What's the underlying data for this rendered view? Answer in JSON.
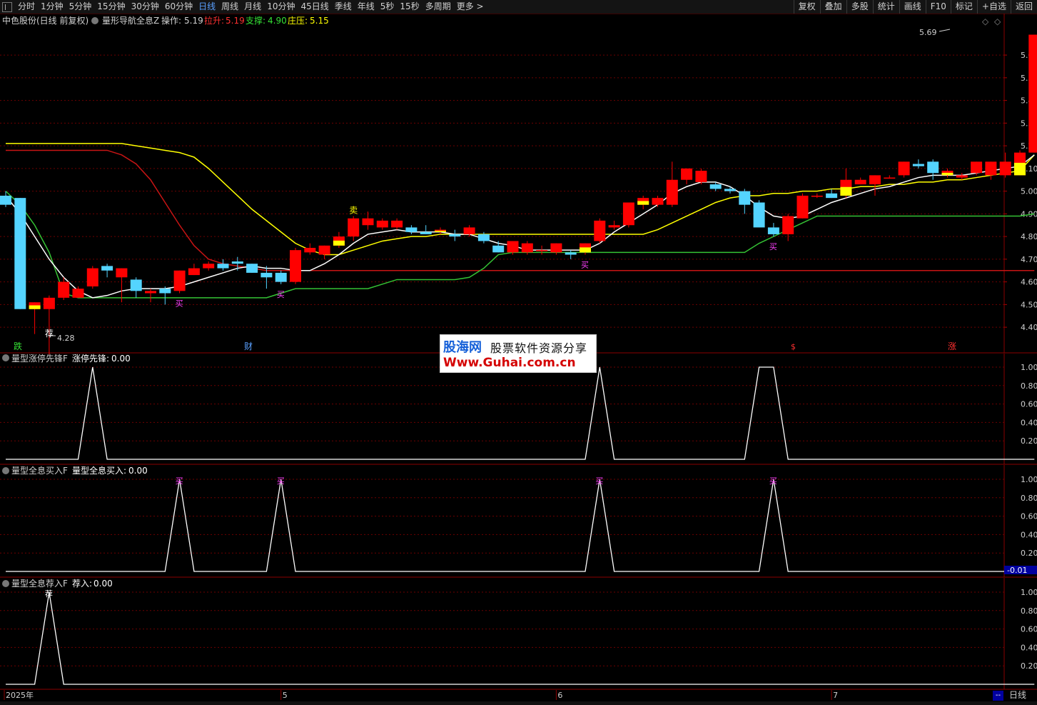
{
  "toolbar": {
    "periods": [
      "分时",
      "1分钟",
      "5分钟",
      "15分钟",
      "30分钟",
      "60分钟",
      "日线",
      "周线",
      "月线",
      "10分钟",
      "45日线",
      "季线",
      "年线",
      "5秒",
      "15秒",
      "多周期",
      "更多 >"
    ],
    "active_index": 6,
    "right_buttons": [
      "复权",
      "叠加",
      "多股",
      "统计",
      "画线",
      "F10",
      "标记",
      "+自选",
      "返回"
    ]
  },
  "main_panel": {
    "stock_label": "中色股份(日线 前复权)",
    "indicator_name": "量形导航全息Z",
    "op_label": "操作:",
    "op_value": "5.19",
    "lift_label": "拉升:",
    "lift_value": "5.19",
    "support_label": "支撑:",
    "support_value": "4.90",
    "dealer_label": "庄压:",
    "dealer_value": "5.15",
    "high_mark": "5.69",
    "low_mark": "4.28",
    "price_ticks": [
      "5.60",
      "5.50",
      "5.40",
      "5.30",
      "5.20",
      "5.10",
      "5.00",
      "4.90",
      "4.80",
      "4.70",
      "4.60",
      "4.50",
      "4.40"
    ],
    "signal_buy": "买",
    "signal_sell": "卖",
    "signal_store": "荐",
    "bottom_tags": {
      "left": "跌",
      "mid": "财",
      "r1": "$",
      "right": "涨"
    }
  },
  "panel1": {
    "indicator_name": "量型涨停先锋F",
    "label": "涨停先锋:",
    "value": "0.00",
    "ticks": [
      "1.00",
      "0.80",
      "0.60",
      "0.40",
      "0.20"
    ]
  },
  "panel2": {
    "indicator_name": "量型全息买入F",
    "label": "量型全息买入:",
    "value": "0.00",
    "ticks": [
      "1.00",
      "0.80",
      "0.60",
      "0.40",
      "0.20"
    ],
    "neg_value": "-0.01",
    "marker": "买"
  },
  "panel3": {
    "indicator_name": "量型全息荐入F",
    "label": "荐入:",
    "value": "0.00",
    "ticks": [
      "1.00",
      "0.80",
      "0.60",
      "0.40",
      "0.20"
    ],
    "marker": "荐"
  },
  "time_axis": {
    "labels": [
      "2025年",
      "5",
      "6",
      "7"
    ]
  },
  "scale_box": "--",
  "period_tag": "日线",
  "watermark": {
    "title": "股海网",
    "subtitle": "股票软件资源分享",
    "url": "Www.Guhai.com.cn"
  },
  "colors": {
    "up": "#ff0000",
    "down": "#54d4ff",
    "yellow": "#ffff00",
    "white": "#ffffff",
    "green": "#34c234",
    "darkred": "#c81414",
    "magenta": "#ff40ff",
    "grid": "#6e0000"
  },
  "chart_data": {
    "type": "candlestick",
    "ylim": [
      4.35,
      5.72
    ],
    "candles": [
      {
        "o": 4.98,
        "h": 5.0,
        "l": 4.93,
        "c": 4.94
      },
      {
        "o": 4.97,
        "h": 4.97,
        "l": 4.48,
        "c": 4.48
      },
      {
        "o": 4.48,
        "h": 4.51,
        "l": 4.37,
        "c": 4.51
      },
      {
        "o": 4.48,
        "h": 4.54,
        "l": 4.28,
        "c": 4.53
      },
      {
        "o": 4.53,
        "h": 4.62,
        "l": 4.52,
        "c": 4.6
      },
      {
        "o": 4.53,
        "h": 4.58,
        "l": 4.53,
        "c": 4.57
      },
      {
        "o": 4.58,
        "h": 4.67,
        "l": 4.57,
        "c": 4.66
      },
      {
        "o": 4.67,
        "h": 4.68,
        "l": 4.62,
        "c": 4.65
      },
      {
        "o": 4.62,
        "h": 4.66,
        "l": 4.51,
        "c": 4.66
      },
      {
        "o": 4.61,
        "h": 4.62,
        "l": 4.53,
        "c": 4.56
      },
      {
        "o": 4.55,
        "h": 4.57,
        "l": 4.51,
        "c": 4.56
      },
      {
        "o": 4.57,
        "h": 4.58,
        "l": 4.5,
        "c": 4.55
      },
      {
        "o": 4.56,
        "h": 4.65,
        "l": 4.55,
        "c": 4.65
      },
      {
        "o": 4.63,
        "h": 4.68,
        "l": 4.63,
        "c": 4.66
      },
      {
        "o": 4.66,
        "h": 4.69,
        "l": 4.65,
        "c": 4.68
      },
      {
        "o": 4.68,
        "h": 4.7,
        "l": 4.65,
        "c": 4.66
      },
      {
        "o": 4.69,
        "h": 4.71,
        "l": 4.65,
        "c": 4.68
      },
      {
        "o": 4.68,
        "h": 4.68,
        "l": 4.64,
        "c": 4.64
      },
      {
        "o": 4.64,
        "h": 4.67,
        "l": 4.57,
        "c": 4.62
      },
      {
        "o": 4.64,
        "h": 4.65,
        "l": 4.59,
        "c": 4.6
      },
      {
        "o": 4.6,
        "h": 4.75,
        "l": 4.59,
        "c": 4.74
      },
      {
        "o": 4.73,
        "h": 4.77,
        "l": 4.72,
        "c": 4.75
      },
      {
        "o": 4.72,
        "h": 4.76,
        "l": 4.7,
        "c": 4.76
      },
      {
        "o": 4.76,
        "h": 4.82,
        "l": 4.75,
        "c": 4.8
      },
      {
        "o": 4.8,
        "h": 4.89,
        "l": 4.78,
        "c": 4.88
      },
      {
        "o": 4.85,
        "h": 4.91,
        "l": 4.83,
        "c": 4.88
      },
      {
        "o": 4.84,
        "h": 4.88,
        "l": 4.83,
        "c": 4.87
      },
      {
        "o": 4.84,
        "h": 4.88,
        "l": 4.83,
        "c": 4.87
      },
      {
        "o": 4.84,
        "h": 4.85,
        "l": 4.81,
        "c": 4.82
      },
      {
        "o": 4.82,
        "h": 4.85,
        "l": 4.81,
        "c": 4.81
      },
      {
        "o": 4.82,
        "h": 4.84,
        "l": 4.81,
        "c": 4.83
      },
      {
        "o": 4.81,
        "h": 4.83,
        "l": 4.78,
        "c": 4.8
      },
      {
        "o": 4.81,
        "h": 4.85,
        "l": 4.8,
        "c": 4.84
      },
      {
        "o": 4.81,
        "h": 4.82,
        "l": 4.77,
        "c": 4.78
      },
      {
        "o": 4.76,
        "h": 4.78,
        "l": 4.73,
        "c": 4.73
      },
      {
        "o": 4.73,
        "h": 4.78,
        "l": 4.72,
        "c": 4.78
      },
      {
        "o": 4.73,
        "h": 4.78,
        "l": 4.72,
        "c": 4.77
      },
      {
        "o": 4.74,
        "h": 4.76,
        "l": 4.72,
        "c": 4.74
      },
      {
        "o": 4.73,
        "h": 4.77,
        "l": 4.72,
        "c": 4.77
      },
      {
        "o": 4.73,
        "h": 4.74,
        "l": 4.7,
        "c": 4.72
      },
      {
        "o": 4.73,
        "h": 4.77,
        "l": 4.72,
        "c": 4.77
      },
      {
        "o": 4.78,
        "h": 4.88,
        "l": 4.77,
        "c": 4.87
      },
      {
        "o": 4.84,
        "h": 4.87,
        "l": 4.83,
        "c": 4.85
      },
      {
        "o": 4.85,
        "h": 4.95,
        "l": 4.84,
        "c": 4.95
      },
      {
        "o": 4.94,
        "h": 4.98,
        "l": 4.92,
        "c": 4.97
      },
      {
        "o": 4.94,
        "h": 4.98,
        "l": 4.93,
        "c": 4.97
      },
      {
        "o": 4.94,
        "h": 5.13,
        "l": 4.93,
        "c": 5.05
      },
      {
        "o": 5.05,
        "h": 5.1,
        "l": 5.03,
        "c": 5.1
      },
      {
        "o": 5.04,
        "h": 5.1,
        "l": 5.03,
        "c": 5.09
      },
      {
        "o": 5.03,
        "h": 5.04,
        "l": 5.0,
        "c": 5.01
      },
      {
        "o": 5.01,
        "h": 5.02,
        "l": 4.99,
        "c": 5.0
      },
      {
        "o": 5.0,
        "h": 5.01,
        "l": 4.9,
        "c": 4.94
      },
      {
        "o": 4.95,
        "h": 4.96,
        "l": 4.85,
        "c": 4.84
      },
      {
        "o": 4.84,
        "h": 4.86,
        "l": 4.8,
        "c": 4.81
      },
      {
        "o": 4.81,
        "h": 4.9,
        "l": 4.78,
        "c": 4.89
      },
      {
        "o": 4.88,
        "h": 4.99,
        "l": 4.88,
        "c": 4.98
      },
      {
        "o": 4.98,
        "h": 4.99,
        "l": 4.97,
        "c": 4.98
      },
      {
        "o": 4.99,
        "h": 5.01,
        "l": 4.97,
        "c": 4.97
      },
      {
        "o": 4.98,
        "h": 5.1,
        "l": 4.97,
        "c": 5.05
      },
      {
        "o": 5.03,
        "h": 5.06,
        "l": 5.03,
        "c": 5.05
      },
      {
        "o": 5.03,
        "h": 5.07,
        "l": 4.98,
        "c": 5.07
      },
      {
        "o": 5.06,
        "h": 5.07,
        "l": 5.06,
        "c": 5.06
      },
      {
        "o": 5.07,
        "h": 5.13,
        "l": 5.06,
        "c": 5.13
      },
      {
        "o": 5.12,
        "h": 5.14,
        "l": 5.1,
        "c": 5.11
      },
      {
        "o": 5.13,
        "h": 5.14,
        "l": 5.05,
        "c": 5.08
      },
      {
        "o": 5.07,
        "h": 5.1,
        "l": 5.06,
        "c": 5.09
      },
      {
        "o": 5.06,
        "h": 5.08,
        "l": 5.05,
        "c": 5.07
      },
      {
        "o": 5.08,
        "h": 5.13,
        "l": 5.07,
        "c": 5.13
      },
      {
        "o": 5.07,
        "h": 5.13,
        "l": 5.05,
        "c": 5.13
      },
      {
        "o": 5.07,
        "h": 5.17,
        "l": 5.06,
        "c": 5.13
      },
      {
        "o": 5.07,
        "h": 5.18,
        "l": 5.07,
        "c": 5.17
      },
      {
        "o": 5.17,
        "h": 5.69,
        "l": 5.17,
        "c": 5.69
      }
    ],
    "white_line": [
      4.98,
      4.9,
      4.8,
      4.7,
      4.62,
      4.56,
      4.53,
      4.54,
      4.56,
      4.57,
      4.57,
      4.57,
      4.58,
      4.6,
      4.62,
      4.64,
      4.66,
      4.67,
      4.66,
      4.66,
      4.65,
      4.65,
      4.68,
      4.72,
      4.77,
      4.81,
      4.82,
      4.83,
      4.82,
      4.82,
      4.82,
      4.81,
      4.81,
      4.79,
      4.77,
      4.76,
      4.74,
      4.74,
      4.74,
      4.74,
      4.74,
      4.77,
      4.82,
      4.86,
      4.9,
      4.94,
      4.99,
      5.02,
      5.04,
      5.04,
      5.02,
      4.98,
      4.93,
      4.89,
      4.88,
      4.89,
      4.92,
      4.95,
      4.97,
      4.99,
      5.01,
      5.02,
      5.04,
      5.06,
      5.07,
      5.07,
      5.07,
      5.08,
      5.09,
      5.1,
      5.11,
      5.16
    ],
    "yellow_line": [
      5.21,
      5.21,
      5.21,
      5.21,
      5.21,
      5.21,
      5.21,
      5.21,
      5.21,
      5.2,
      5.19,
      5.18,
      5.17,
      5.15,
      5.1,
      5.04,
      4.98,
      4.92,
      4.87,
      4.82,
      4.77,
      4.74,
      4.72,
      4.72,
      4.74,
      4.76,
      4.78,
      4.79,
      4.8,
      4.8,
      4.81,
      4.81,
      4.81,
      4.81,
      4.81,
      4.81,
      4.81,
      4.81,
      4.81,
      4.81,
      4.81,
      4.81,
      4.81,
      4.81,
      4.81,
      4.83,
      4.86,
      4.89,
      4.92,
      4.95,
      4.97,
      4.98,
      4.98,
      4.99,
      4.99,
      5.0,
      5.0,
      5.01,
      5.01,
      5.02,
      5.02,
      5.03,
      5.03,
      5.04,
      5.04,
      5.05,
      5.05,
      5.06,
      5.07,
      5.08,
      5.09,
      5.16
    ],
    "red_line": [
      5.18,
      5.18,
      5.18,
      5.18,
      5.18,
      5.18,
      5.18,
      5.18,
      5.16,
      5.12,
      5.05,
      4.95,
      4.85,
      4.76,
      4.7,
      4.68,
      4.67,
      4.66,
      4.65,
      4.65,
      4.65,
      4.65,
      4.65,
      4.65,
      4.65,
      4.65,
      4.65,
      4.65,
      4.65,
      4.65,
      4.65,
      4.65,
      4.65,
      4.65,
      4.65,
      4.65,
      4.65,
      4.65,
      4.65,
      4.65,
      4.65,
      4.65,
      4.65,
      4.65,
      4.65,
      4.65,
      4.65,
      4.65,
      4.65,
      4.65,
      4.65,
      4.65,
      4.65,
      4.65,
      4.65,
      4.65,
      4.65,
      4.65,
      4.65,
      4.65,
      4.65,
      4.65,
      4.65,
      4.65,
      4.65,
      4.65,
      4.65,
      4.65,
      4.65,
      4.65,
      4.65,
      4.65
    ],
    "green_line": [
      5.0,
      4.94,
      4.85,
      4.73,
      4.55,
      4.53,
      4.53,
      4.53,
      4.53,
      4.53,
      4.53,
      4.53,
      4.53,
      4.53,
      4.53,
      4.53,
      4.53,
      4.53,
      4.53,
      4.55,
      4.57,
      4.57,
      4.57,
      4.57,
      4.57,
      4.57,
      4.59,
      4.61,
      4.61,
      4.61,
      4.61,
      4.61,
      4.62,
      4.66,
      4.72,
      4.73,
      4.73,
      4.73,
      4.73,
      4.73,
      4.73,
      4.73,
      4.73,
      4.73,
      4.73,
      4.73,
      4.73,
      4.73,
      4.73,
      4.73,
      4.73,
      4.73,
      4.77,
      4.8,
      4.83,
      4.86,
      4.89,
      4.89,
      4.89,
      4.89,
      4.89,
      4.89,
      4.89,
      4.89,
      4.89,
      4.89,
      4.89,
      4.89,
      4.89,
      4.89,
      4.89,
      4.9
    ],
    "p1_values": [
      0,
      0,
      0,
      0,
      0,
      0,
      1,
      0,
      0,
      0,
      0,
      0,
      0,
      0,
      0,
      0,
      0,
      0,
      0,
      0,
      0,
      0,
      0,
      0,
      0,
      0,
      0,
      0,
      0,
      0,
      0,
      0,
      0,
      0,
      0,
      0,
      0,
      0,
      0,
      0,
      0,
      1,
      0,
      0,
      0,
      0,
      0,
      0,
      0,
      0,
      0,
      0,
      1,
      1,
      0,
      0,
      0,
      0,
      0,
      0,
      0,
      0,
      0,
      0,
      0,
      0,
      0,
      0,
      0,
      0,
      0,
      0
    ],
    "p2_values": [
      0,
      0,
      0,
      0,
      0,
      0,
      0,
      0,
      0,
      0,
      0,
      0,
      1,
      0,
      0,
      0,
      0,
      0,
      0,
      1,
      0,
      0,
      0,
      0,
      0,
      0,
      0,
      0,
      0,
      0,
      0,
      0,
      0,
      0,
      0,
      0,
      0,
      0,
      0,
      0,
      0,
      1,
      0,
      0,
      0,
      0,
      0,
      0,
      0,
      0,
      0,
      0,
      0,
      1,
      0,
      0,
      0,
      0,
      0,
      0,
      0,
      0,
      0,
      0,
      0,
      0,
      0,
      0,
      0,
      0,
      0,
      0
    ],
    "p3_values": [
      0,
      0,
      0,
      1,
      0,
      0,
      0,
      0,
      0,
      0,
      0,
      0,
      0,
      0,
      0,
      0,
      0,
      0,
      0,
      0,
      0,
      0,
      0,
      0,
      0,
      0,
      0,
      0,
      0,
      0,
      0,
      0,
      0,
      0,
      0,
      0,
      0,
      0,
      0,
      0,
      0,
      0,
      0,
      0,
      0,
      0,
      0,
      0,
      0,
      0,
      0,
      0,
      0,
      0,
      0,
      0,
      0,
      0,
      0,
      0,
      0,
      0,
      0,
      0,
      0,
      0,
      0,
      0,
      0,
      0,
      0,
      0
    ],
    "buy_at": [
      12,
      19,
      40,
      53
    ],
    "sell_at": [
      24
    ],
    "store_at": [
      3
    ]
  }
}
